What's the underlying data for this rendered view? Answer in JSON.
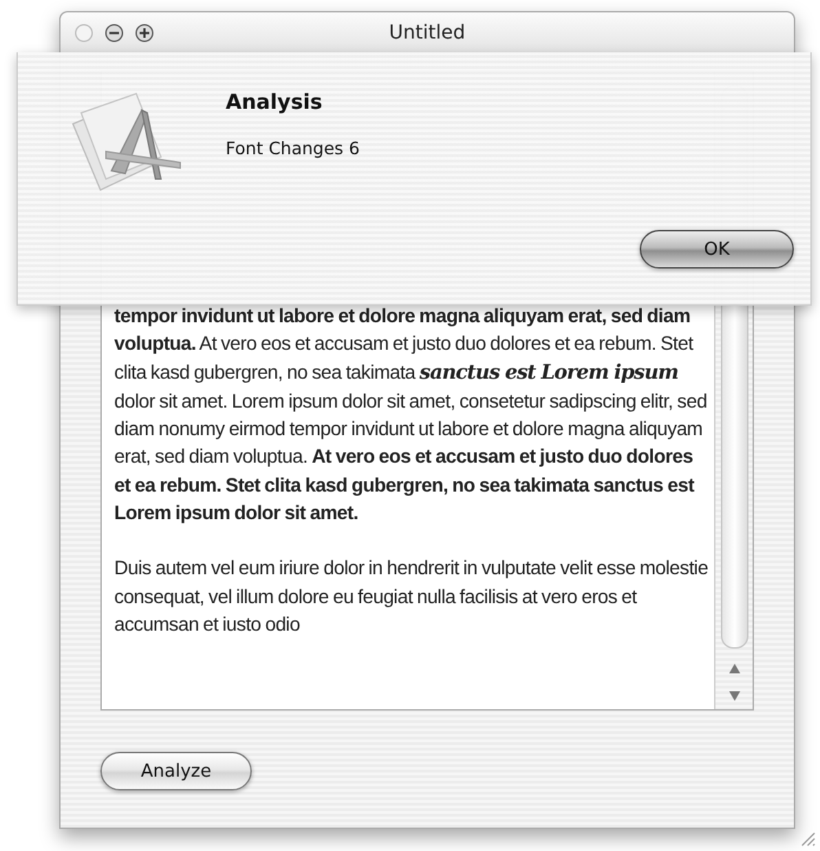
{
  "window": {
    "title": "Untitled"
  },
  "sheet": {
    "title": "Analysis",
    "message": "Font Changes 6",
    "buttons": [
      {
        "label": "OK",
        "default": true
      }
    ]
  },
  "text_view": {
    "paragraphs": [
      "**tempor invidunt ut labore et dolore magna aliquyam erat, sed diam voluptua.** At vero eos et accusam et justo duo dolores et ea rebum. Stet clita kasd gubergren, no sea takimata *sanctus est Lorem ipsum* dolor sit amet. Lorem ipsum dolor sit amet, consetetur sadipscing elitr, sed diam nonumy eirmod tempor invidunt ut labore et dolore magna aliquyam erat, sed diam voluptua. **At vero eos et accusam et justo duo dolores et ea rebum. Stet clita kasd gubergren, no sea takimata sanctus est Lorem ipsum dolor sit amet.**",
      "Duis autem vel eum iriure dolor in hendrerit in vulputate velit esse molestie consequat, vel illum dolore eu feugiat nulla facilisis at vero eros et accumsan et iusto odio"
    ]
  },
  "buttons": [
    {
      "label": "Analyze",
      "default": false
    }
  ]
}
